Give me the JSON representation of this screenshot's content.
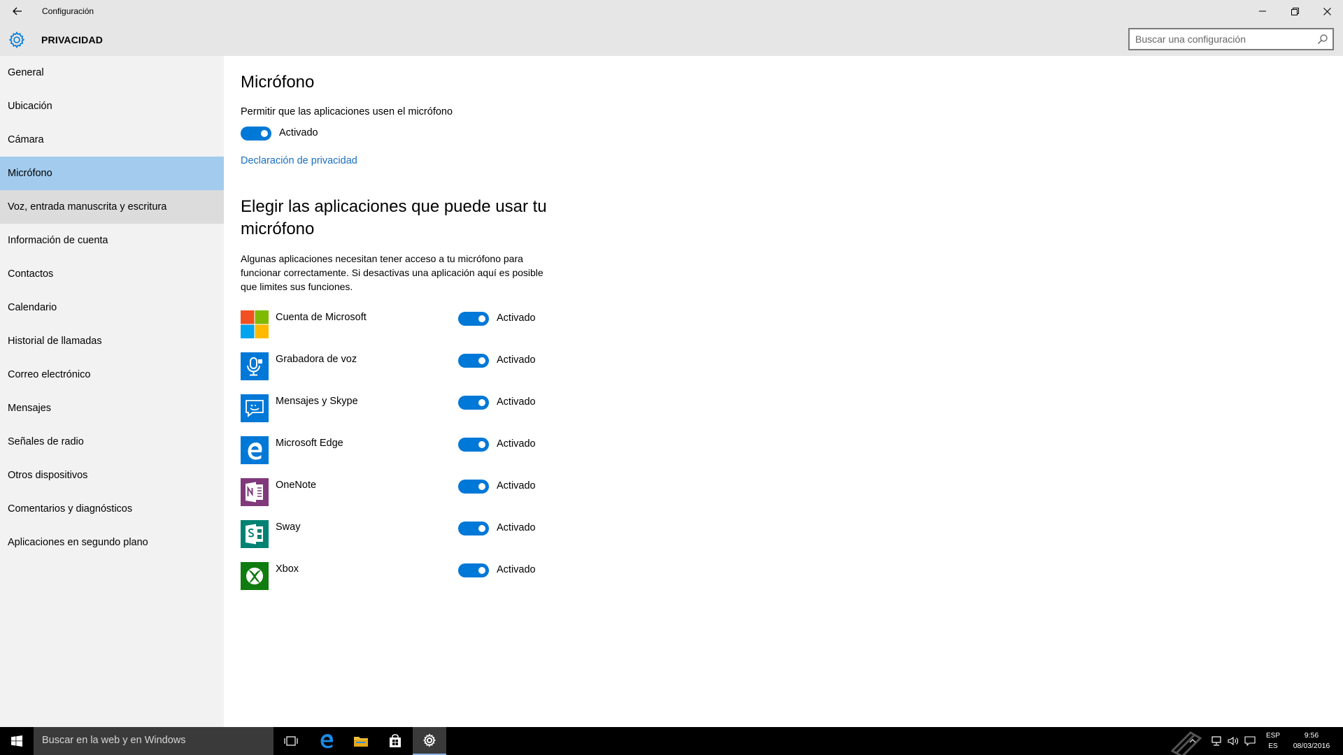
{
  "window": {
    "title": "Configuración",
    "section_title": "PRIVACIDAD"
  },
  "search": {
    "placeholder": "Buscar una configuración"
  },
  "sidebar": {
    "items": [
      {
        "label": "General"
      },
      {
        "label": "Ubicación"
      },
      {
        "label": "Cámara"
      },
      {
        "label": "Micrófono"
      },
      {
        "label": "Voz, entrada manuscrita y escritura"
      },
      {
        "label": "Información de cuenta"
      },
      {
        "label": "Contactos"
      },
      {
        "label": "Calendario"
      },
      {
        "label": "Historial de llamadas"
      },
      {
        "label": "Correo electrónico"
      },
      {
        "label": "Mensajes"
      },
      {
        "label": "Señales de radio"
      },
      {
        "label": "Otros dispositivos"
      },
      {
        "label": "Comentarios y diagnósticos"
      },
      {
        "label": "Aplicaciones en segundo plano"
      }
    ],
    "selected": "Micrófono",
    "hovered": "Voz, entrada manuscrita y escritura"
  },
  "main": {
    "title": "Micrófono",
    "allow_label": "Permitir que las aplicaciones usen el micrófono",
    "allow_state": "Activado",
    "privacy_link": "Declaración de privacidad",
    "choose_title": "Elegir las aplicaciones que puede usar tu micrófono",
    "description": "Algunas aplicaciones necesitan tener acceso a tu micrófono para funcionar correctamente. Si desactivas una aplicación aquí es posible que limites sus funciones.",
    "apps": [
      {
        "name": "Cuenta de Microsoft",
        "state": "Activado",
        "icon": "microsoft-logo-icon"
      },
      {
        "name": "Grabadora de voz",
        "state": "Activado",
        "icon": "voice-recorder-icon"
      },
      {
        "name": "Mensajes y Skype",
        "state": "Activado",
        "icon": "messaging-icon"
      },
      {
        "name": "Microsoft Edge",
        "state": "Activado",
        "icon": "edge-icon"
      },
      {
        "name": "OneNote",
        "state": "Activado",
        "icon": "onenote-icon"
      },
      {
        "name": "Sway",
        "state": "Activado",
        "icon": "sway-icon"
      },
      {
        "name": "Xbox",
        "state": "Activado",
        "icon": "xbox-icon"
      }
    ]
  },
  "taskbar": {
    "search_placeholder": "Buscar en la web y en Windows",
    "lang_top": "ESP",
    "lang_bottom": "ES",
    "time": "9:56",
    "date": "08/03/2016"
  },
  "colors": {
    "accent": "#0078d7",
    "selected_nav": "#a2cbee",
    "link": "#1a6fbf",
    "chrome": "#e6e6e6",
    "sidebar": "#f2f2f2"
  }
}
